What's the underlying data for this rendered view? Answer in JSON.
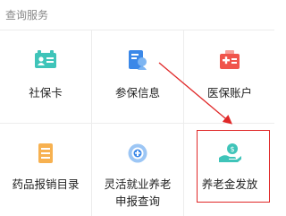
{
  "section": {
    "title": "查询服务"
  },
  "items": [
    {
      "label": "社保卡",
      "icon": "social-security-card-icon"
    },
    {
      "label": "参保信息",
      "icon": "insurance-info-icon"
    },
    {
      "label": "医保账户",
      "icon": "medical-insurance-account-icon"
    },
    {
      "label": "药品报销目录",
      "icon": "drug-reimbursement-list-icon"
    },
    {
      "label": "灵活就业养老申报查询",
      "icon": "flexible-employment-pension-query-icon"
    },
    {
      "label": "养老金发放",
      "icon": "pension-payment-icon"
    }
  ],
  "annotation": {
    "color": "#e02828"
  },
  "colors": {
    "teal": "#3fc4b9",
    "blue": "#3b88e8",
    "red": "#f0554c",
    "orange": "#f7b150"
  }
}
